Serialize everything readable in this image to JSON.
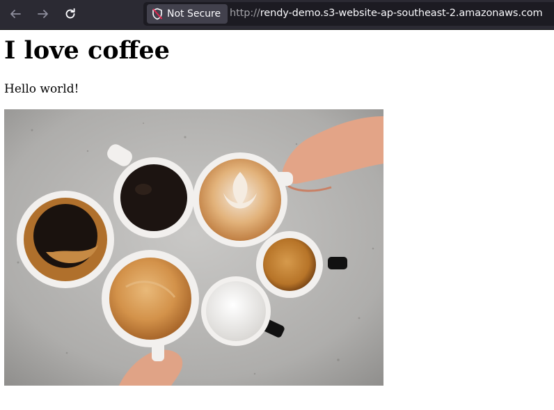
{
  "browser": {
    "security_label": "Not Secure",
    "url_scheme": "http://",
    "url_host": "rendy-demo.s3-website-ap-southeast-2.amazonaws.com"
  },
  "page": {
    "title": "I love coffee",
    "text": "Hello world!",
    "image": {
      "subject": "coffee cups from above",
      "icon": "coffee-cups-image"
    }
  },
  "colors": {
    "toolbar": "#2b2a33",
    "urlbar": "#1c1b22",
    "chip": "#42414d",
    "insecure_red": "#e22850"
  }
}
